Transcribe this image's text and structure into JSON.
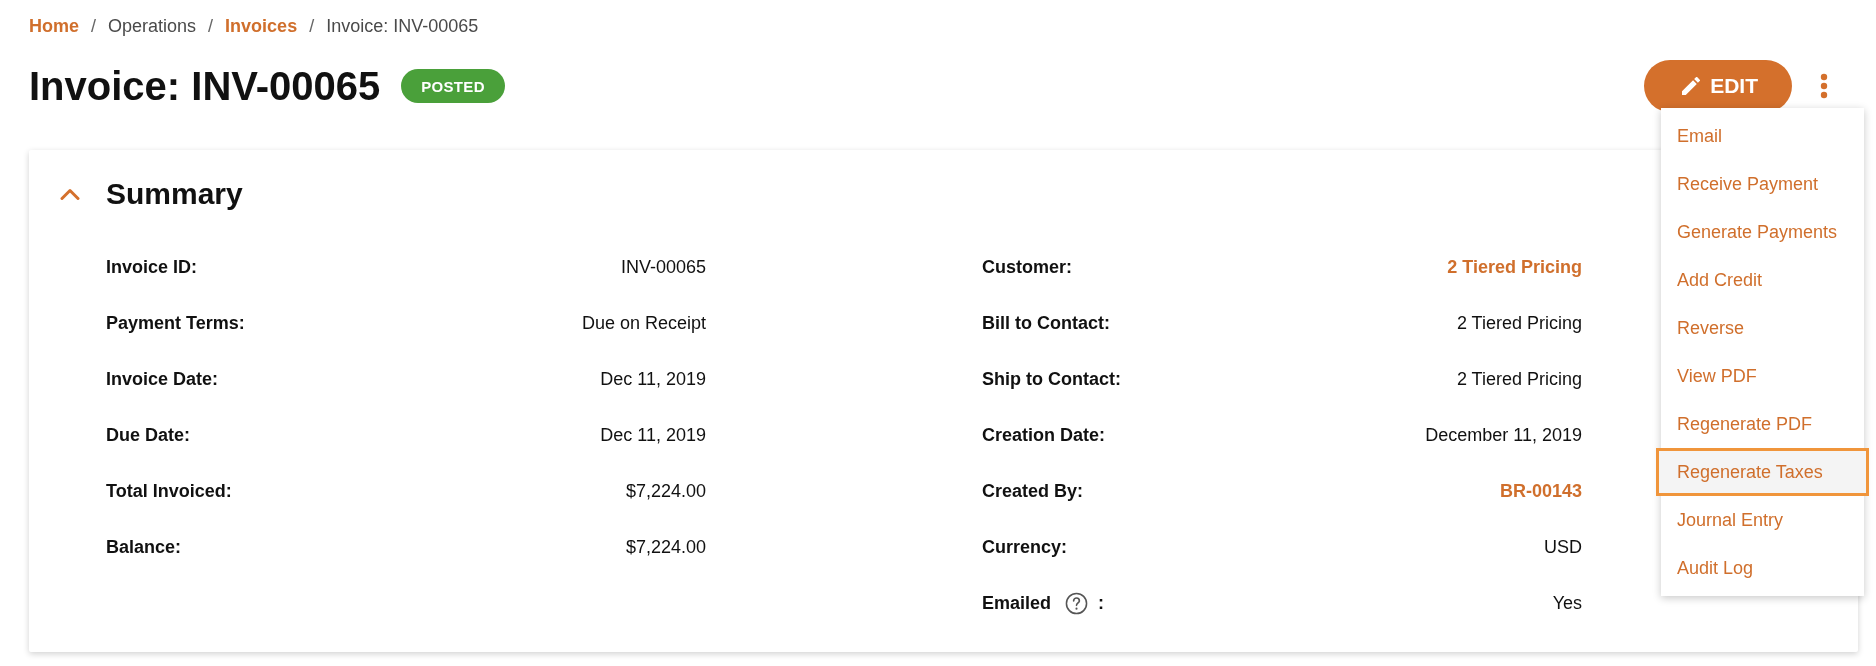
{
  "breadcrumbs": [
    {
      "label": "Home",
      "link": true
    },
    {
      "separator": "/",
      "label": "Operations",
      "link": false
    },
    {
      "separator": "/",
      "label": "Invoices",
      "link": true
    },
    {
      "separator": "/",
      "label": "Invoice: INV-00065",
      "link": false
    }
  ],
  "header": {
    "title": "Invoice: INV-00065",
    "status": "POSTED",
    "edit_button": "EDIT"
  },
  "actions_menu": {
    "open": true,
    "items": [
      {
        "label": "Email",
        "selected": false
      },
      {
        "label": "Receive Payment",
        "selected": false
      },
      {
        "label": "Generate Payments",
        "selected": false
      },
      {
        "label": "Add Credit",
        "selected": false
      },
      {
        "label": "Reverse",
        "selected": false
      },
      {
        "label": "View PDF",
        "selected": false
      },
      {
        "label": "Regenerate PDF",
        "selected": false
      },
      {
        "label": "Regenerate Taxes",
        "selected": true
      },
      {
        "label": "Journal Entry",
        "selected": false
      },
      {
        "label": "Audit Log",
        "selected": false
      }
    ]
  },
  "summary": {
    "title": "Summary",
    "expanded": true,
    "columns": [
      {
        "fields": [
          {
            "label": "Invoice ID:",
            "value": "INV-00065",
            "link": false,
            "help": false
          },
          {
            "label": "Payment Terms:",
            "value": "Due on Receipt",
            "link": false,
            "help": false
          },
          {
            "label": "Invoice Date:",
            "value": "Dec 11, 2019",
            "link": false,
            "help": false
          },
          {
            "label": "Due Date:",
            "value": "Dec 11, 2019",
            "link": false,
            "help": false
          },
          {
            "label": "Total Invoiced:",
            "value": "$7,224.00",
            "link": false,
            "help": false
          },
          {
            "label": "Balance:",
            "value": "$7,224.00",
            "link": false,
            "help": false
          }
        ]
      },
      {
        "fields": [
          {
            "label": "Customer:",
            "value": "2 Tiered Pricing",
            "link": true,
            "help": false
          },
          {
            "label": "Bill to Contact:",
            "value": "2 Tiered Pricing",
            "link": false,
            "help": false
          },
          {
            "label": "Ship to Contact:",
            "value": "2 Tiered Pricing",
            "link": false,
            "help": false
          },
          {
            "label": "Creation Date:",
            "value": "December 11, 2019",
            "link": false,
            "help": false
          },
          {
            "label": "Created By:",
            "value": "BR-00143",
            "link": true,
            "help": false
          },
          {
            "label": "Currency:",
            "value": "USD",
            "link": false,
            "help": false
          },
          {
            "label": "Emailed",
            "suffix": ":",
            "value": "Yes",
            "link": false,
            "help": true
          }
        ]
      }
    ]
  }
}
